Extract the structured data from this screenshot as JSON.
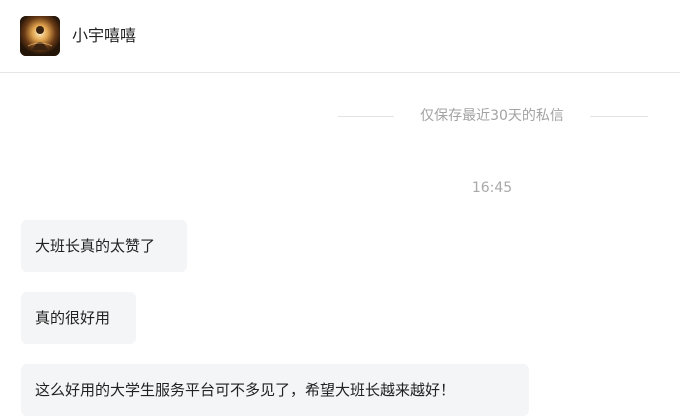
{
  "header": {
    "contact_name": "小宇嘻嘻",
    "avatar_icon": "avatar-image"
  },
  "chat": {
    "notice": "仅保存最近30天的私信",
    "timestamp": "16:45",
    "messages": [
      {
        "text": "大班长真的太赞了"
      },
      {
        "text": "真的很好用"
      },
      {
        "text": "这么好用的大学生服务平台可不多见了，希望大班长越来越好！"
      }
    ]
  },
  "colors": {
    "bubble_bg": "#f4f5f7",
    "muted_text": "#a3a3a3",
    "divider": "#e6e6e6"
  }
}
